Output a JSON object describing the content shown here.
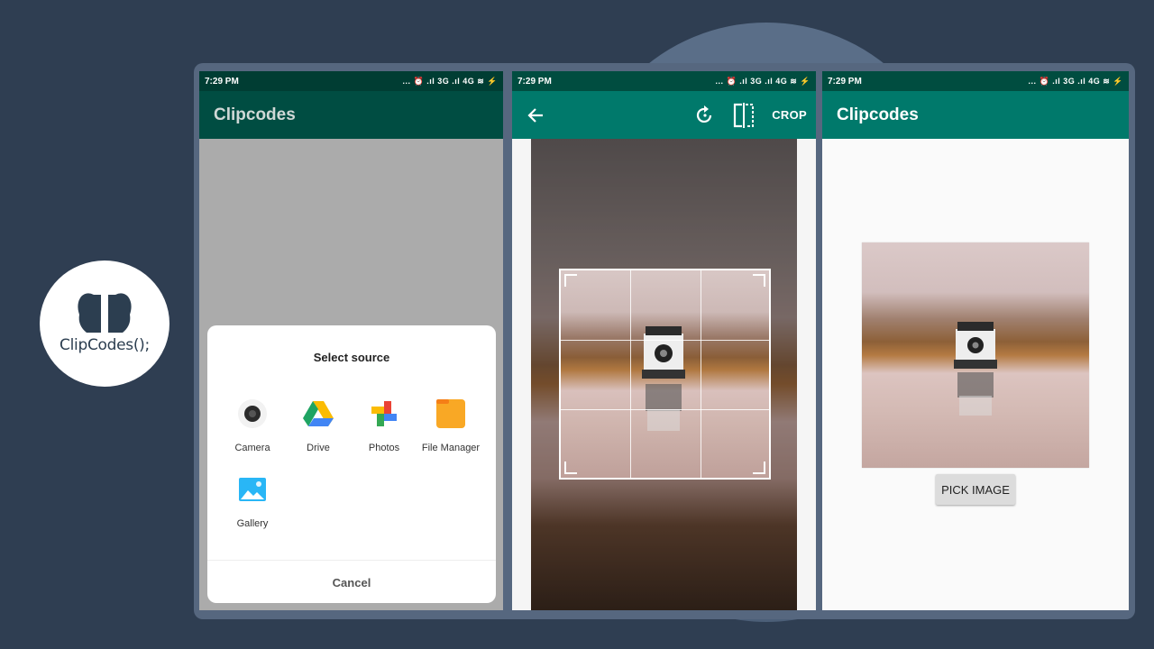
{
  "logo": {
    "text": "ClipCodes();"
  },
  "statusbar": {
    "time": "7:29 PM",
    "icons": "... ⏰ .ıl 3G .ıl 4G ≋ ⚡"
  },
  "phone1": {
    "title": "Clipcodes",
    "dialog": {
      "title": "Select source",
      "sources": [
        {
          "label": "Camera",
          "icon": "camera-icon"
        },
        {
          "label": "Drive",
          "icon": "drive-icon"
        },
        {
          "label": "Photos",
          "icon": "photos-icon"
        },
        {
          "label": "File Manager",
          "icon": "folder-icon"
        },
        {
          "label": "Gallery",
          "icon": "gallery-icon"
        }
      ],
      "cancel": "Cancel"
    }
  },
  "phone2": {
    "crop_label": "CROP",
    "tools": [
      "back-arrow-icon",
      "rotate-icon",
      "flip-icon"
    ]
  },
  "phone3": {
    "title": "Clipcodes",
    "pick_button": "PICK IMAGE"
  },
  "colors": {
    "primary": "#00796b",
    "primary_dark": "#004d40",
    "background": "#2f3e52"
  }
}
